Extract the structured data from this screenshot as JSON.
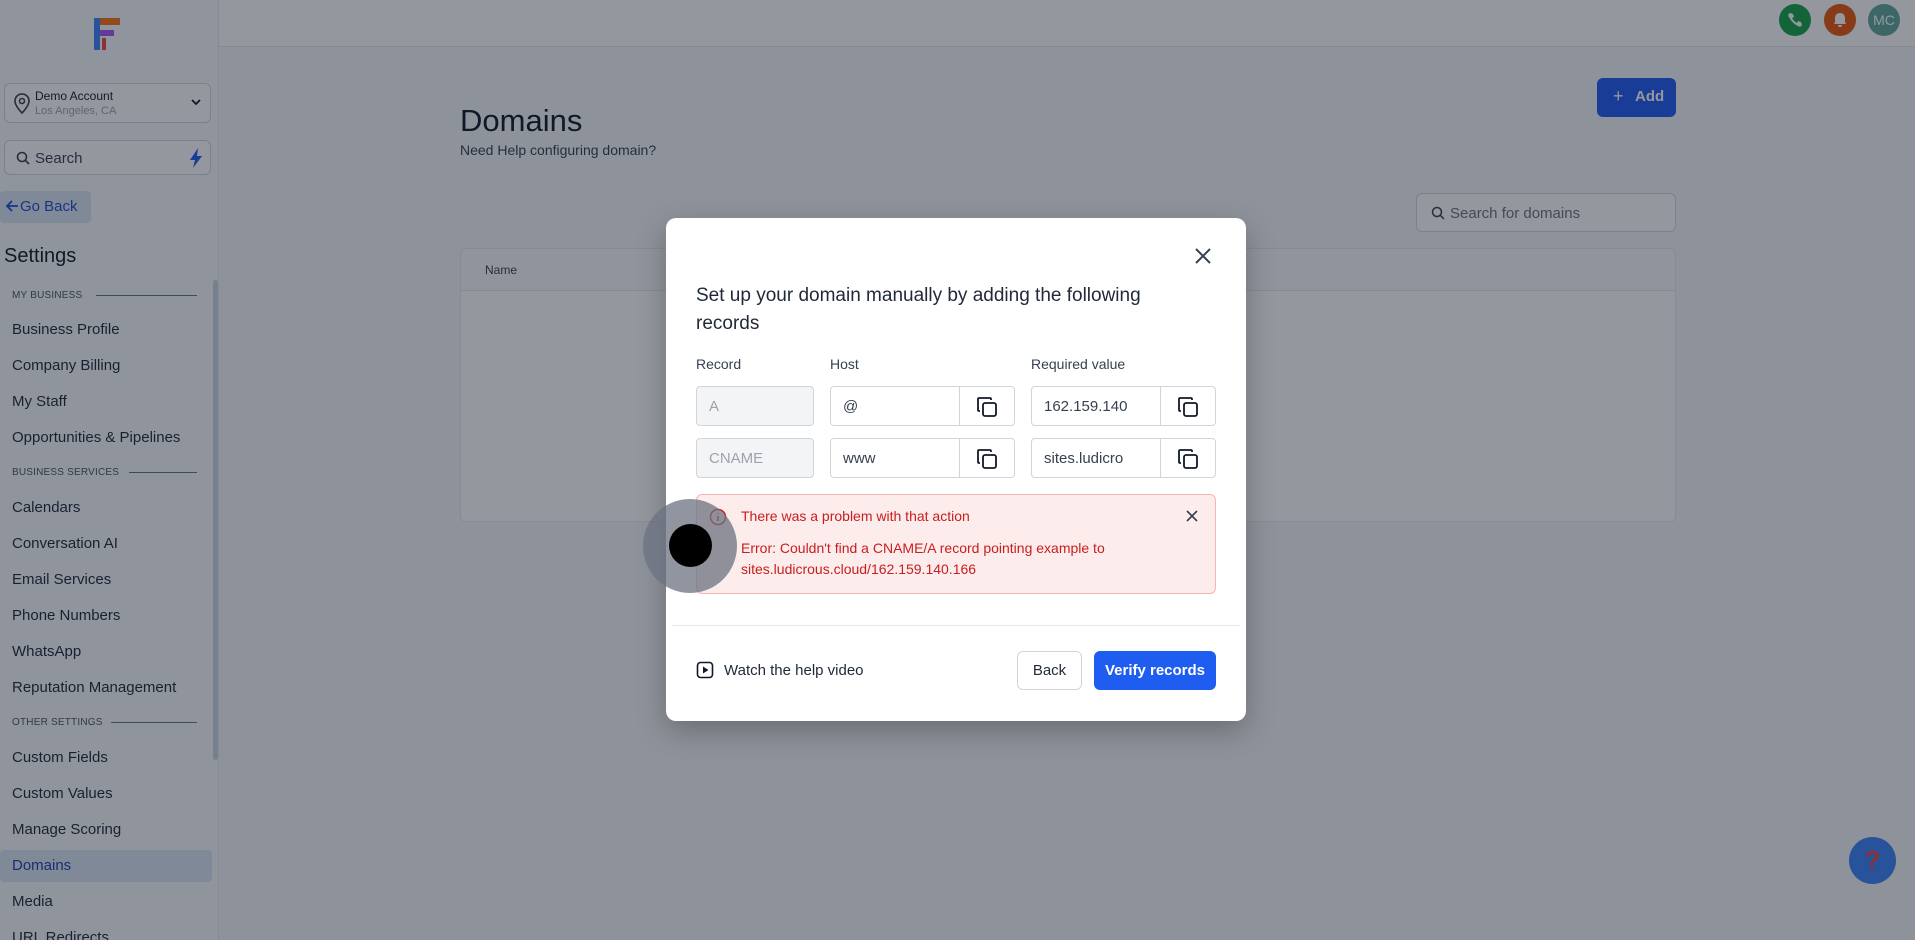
{
  "sidebar": {
    "account_name": "Demo Account",
    "account_location": "Los Angeles, CA",
    "search_placeholder": "Search",
    "go_back": "Go Back",
    "settings_title": "Settings",
    "sections": [
      "MY BUSINESS",
      "BUSINESS SERVICES",
      "OTHER SETTINGS"
    ],
    "items": [
      "Business Profile",
      "Company Billing",
      "My Staff",
      "Opportunities & Pipelines",
      "Calendars",
      "Conversation AI",
      "Email Services",
      "Phone Numbers",
      "WhatsApp",
      "Reputation Management",
      "Custom Fields",
      "Custom Values",
      "Manage Scoring",
      "Domains",
      "Media",
      "URL Redirects"
    ],
    "active_item": "Domains"
  },
  "topbar": {
    "avatar_initials": "MC"
  },
  "main": {
    "title": "Domains",
    "help_text": "Need Help configuring domain?",
    "add_label": "Add",
    "search_placeholder": "Search for domains",
    "table_header_name": "Name"
  },
  "modal": {
    "title": "Set up your domain manually by adding the following records",
    "col_record": "Record",
    "col_host": "Host",
    "col_value": "Required value",
    "rows": [
      {
        "record": "A",
        "host": "@",
        "value": "162.159.140"
      },
      {
        "record": "CNAME",
        "host": "www",
        "value": "sites.ludicro"
      }
    ],
    "alert_title": "There was a problem with that action",
    "alert_message": "Error: Couldn't find a CNAME/A record pointing example to sites.ludicrous.cloud/162.159.140.166",
    "help_video": "Watch the help video",
    "back_label": "Back",
    "verify_label": "Verify records"
  },
  "colors": {
    "primary": "#1f5cf0",
    "error": "#c81e1e",
    "active_nav": "#dbe5f5"
  },
  "help_fab": "?"
}
